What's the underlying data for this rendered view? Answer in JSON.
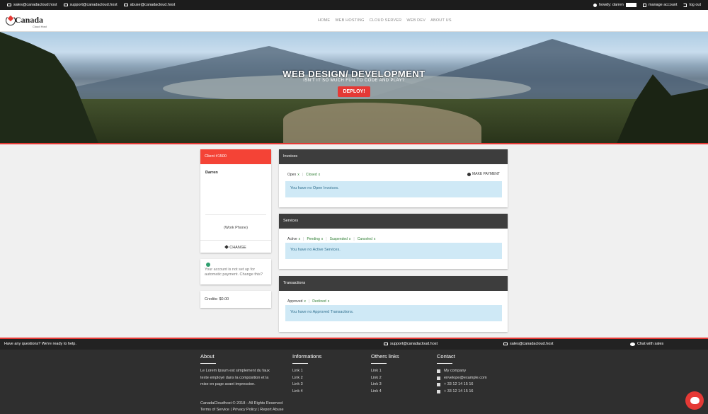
{
  "topbar": {
    "emails": [
      "sales@canadacloud.host",
      "support@canadacloud.host",
      "abuse@canadacloud.host"
    ],
    "howdy": "howdy: darren",
    "manage_account": "manage account",
    "logout": "log out"
  },
  "header": {
    "logo_text": "Canada",
    "logo_sub": "Cloud Host",
    "nav": [
      "HOME",
      "WEB HOSTING",
      "CLOUD SERVER",
      "WEB DEV",
      "ABOUT US"
    ]
  },
  "hero": {
    "title": "WEB DESIGN/ DEVELOPMENT",
    "subtitle": "ISN'T IT SO MUCH FUN TO CODE AND PLAY?",
    "cta": "DEPLOY!"
  },
  "client": {
    "id": "Client #1500",
    "name": "Darren",
    "phone": "(Work Phone)",
    "change": "CHANGE"
  },
  "autopay": {
    "text": "Your account is not set up for automatic payment. Change this?"
  },
  "credits": {
    "text": "Credits: $0.00"
  },
  "invoices": {
    "title": "Invoices",
    "tabs": [
      "Open",
      "Closed"
    ],
    "make_payment": "MAKE PAYMENT",
    "notice": "You have no Open Invoices."
  },
  "services": {
    "title": "Services",
    "tabs": [
      "Active",
      "Pending",
      "Suspended",
      "Canceled"
    ],
    "notice": "You have no Active Services."
  },
  "transactions": {
    "title": "Transactions",
    "tabs": [
      "Approved",
      "Declined"
    ],
    "notice": "You have no Approved Transactions."
  },
  "footer_bar": {
    "question": "Have any questions? We're ready to help.",
    "support": "support@canadacloud.host",
    "sales": "sales@canadacloud.host",
    "chat": "Chat with sales"
  },
  "footer": {
    "about_title": "About",
    "about_text": "Le Lorem Ipsum est simplement du faux texte employé dans la composition et la mise en page avant impression.",
    "info_title": "Informations",
    "info_links": [
      "Link 1",
      "Link 2",
      "Link 3",
      "Link 4"
    ],
    "others_title": "Others links",
    "others_links": [
      "Link 1",
      "Link 2",
      "Link 3",
      "Link 4"
    ],
    "contact_title": "Contact",
    "contact": [
      "My company",
      "envelope@example.com",
      "+ 33 12 14 15 16",
      "+ 33 12 14 15 16"
    ],
    "copyright": "CanadaCloudhost © 2018 - All Rights Reserved",
    "legal_links": [
      "Terms of Service",
      "Privacy Policy",
      "Report Abuse"
    ]
  },
  "colors": {
    "accent": "#e53935",
    "dark": "#3d3d3d",
    "notice_bg": "#cfe9f6",
    "notice_text": "#31708f"
  }
}
